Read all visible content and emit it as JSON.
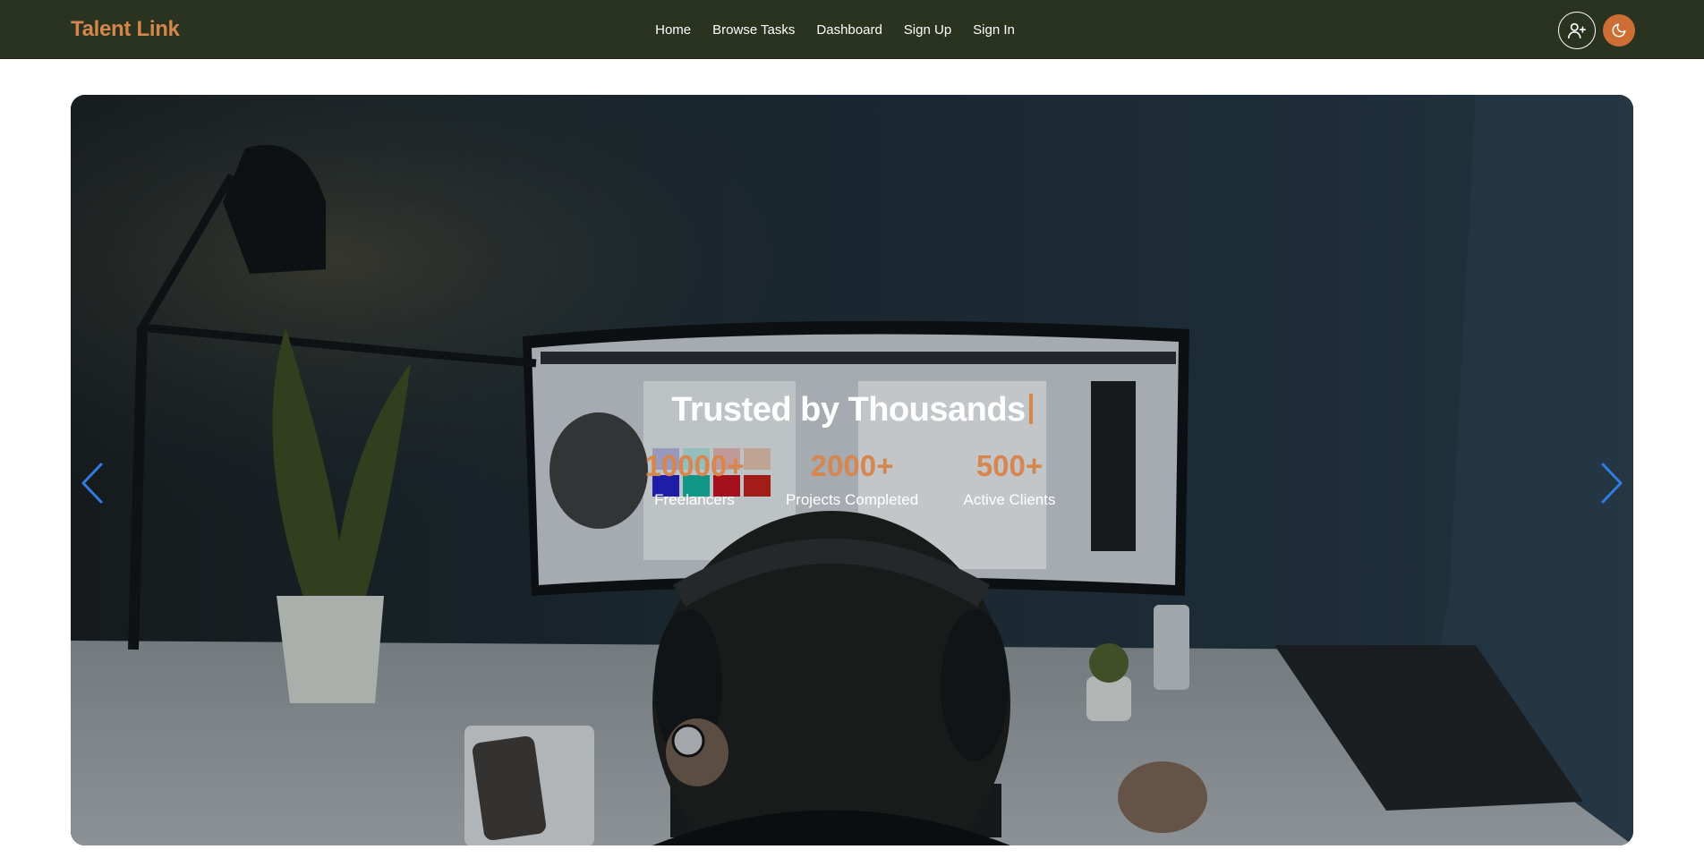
{
  "navbar": {
    "brand": "Talent Link",
    "links": [
      "Home",
      "Browse Tasks",
      "Dashboard",
      "Sign Up",
      "Sign In"
    ],
    "actions": {
      "add_user_icon": "user-plus-icon",
      "theme_icon": "moon-icon"
    }
  },
  "hero": {
    "headline": "Trusted by Thousands",
    "stats": [
      {
        "value": "10000+",
        "label": "Freelancers"
      },
      {
        "value": "2000+",
        "label": "Projects Completed"
      },
      {
        "value": "500+",
        "label": "Active Clients"
      }
    ],
    "prev_icon": "chevron-left-icon",
    "next_icon": "chevron-right-icon"
  },
  "colors": {
    "navbar_bg": "#2a3220",
    "brand": "#d3874c",
    "accent": "#d6864e",
    "theme_button": "#cd6e34",
    "carousel_arrow": "#2f7de0"
  }
}
